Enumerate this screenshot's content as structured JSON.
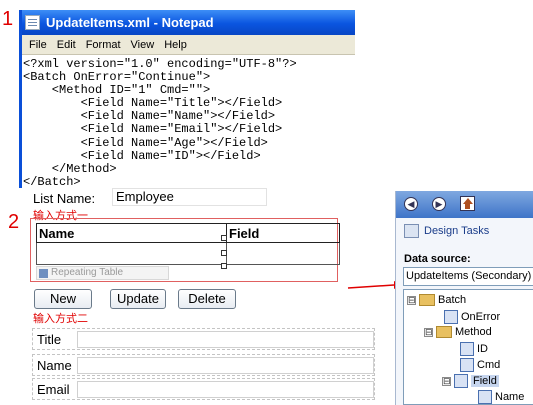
{
  "markers": {
    "one": "1",
    "two": "2"
  },
  "notepad": {
    "title": "UpdateItems.xml - Notepad",
    "menu": [
      "File",
      "Edit",
      "Format",
      "View",
      "Help"
    ],
    "lines": [
      "<?xml version=\"1.0\" encoding=\"UTF-8\"?>",
      "<Batch OnError=\"Continue\">",
      "    <Method ID=\"1\" Cmd=\"\">",
      "        <Field Name=\"Title\"></Field>",
      "        <Field Name=\"Name\"></Field>",
      "        <Field Name=\"Email\"></Field>",
      "        <Field Name=\"Age\"></Field>",
      "        <Field Name=\"ID\"></Field>",
      "    </Method>",
      "</Batch>"
    ]
  },
  "form": {
    "list_name_label": "List Name:",
    "list_name_value": "Employee",
    "input_method_one": "输入方式一",
    "input_method_two": "输入方式二",
    "repeating_table": {
      "headers": [
        "Name",
        "Field"
      ],
      "label": "Repeating Table"
    },
    "buttons": {
      "new": "New",
      "update": "Update",
      "delete": "Delete"
    },
    "fields": [
      "Title",
      "Name",
      "Email"
    ]
  },
  "task_pane": {
    "design_tasks": "Design Tasks",
    "data_source_label": "Data source:",
    "data_source_value": "UpdateItems (Secondary)",
    "tree": [
      {
        "label": "Batch",
        "type": "folder",
        "expander": "⊟"
      },
      {
        "label": "OnError",
        "type": "attribute"
      },
      {
        "label": "Method",
        "type": "folder",
        "expander": "⊟"
      },
      {
        "label": "ID",
        "type": "attribute"
      },
      {
        "label": "Cmd",
        "type": "attribute"
      },
      {
        "label": "Field",
        "type": "repeating-group",
        "expander": "⊟",
        "selected": true
      },
      {
        "label": "Name",
        "type": "attribute"
      }
    ]
  },
  "colors": {
    "annotation_red": "#e00000",
    "titlebar_blue": "#0a55e0"
  }
}
